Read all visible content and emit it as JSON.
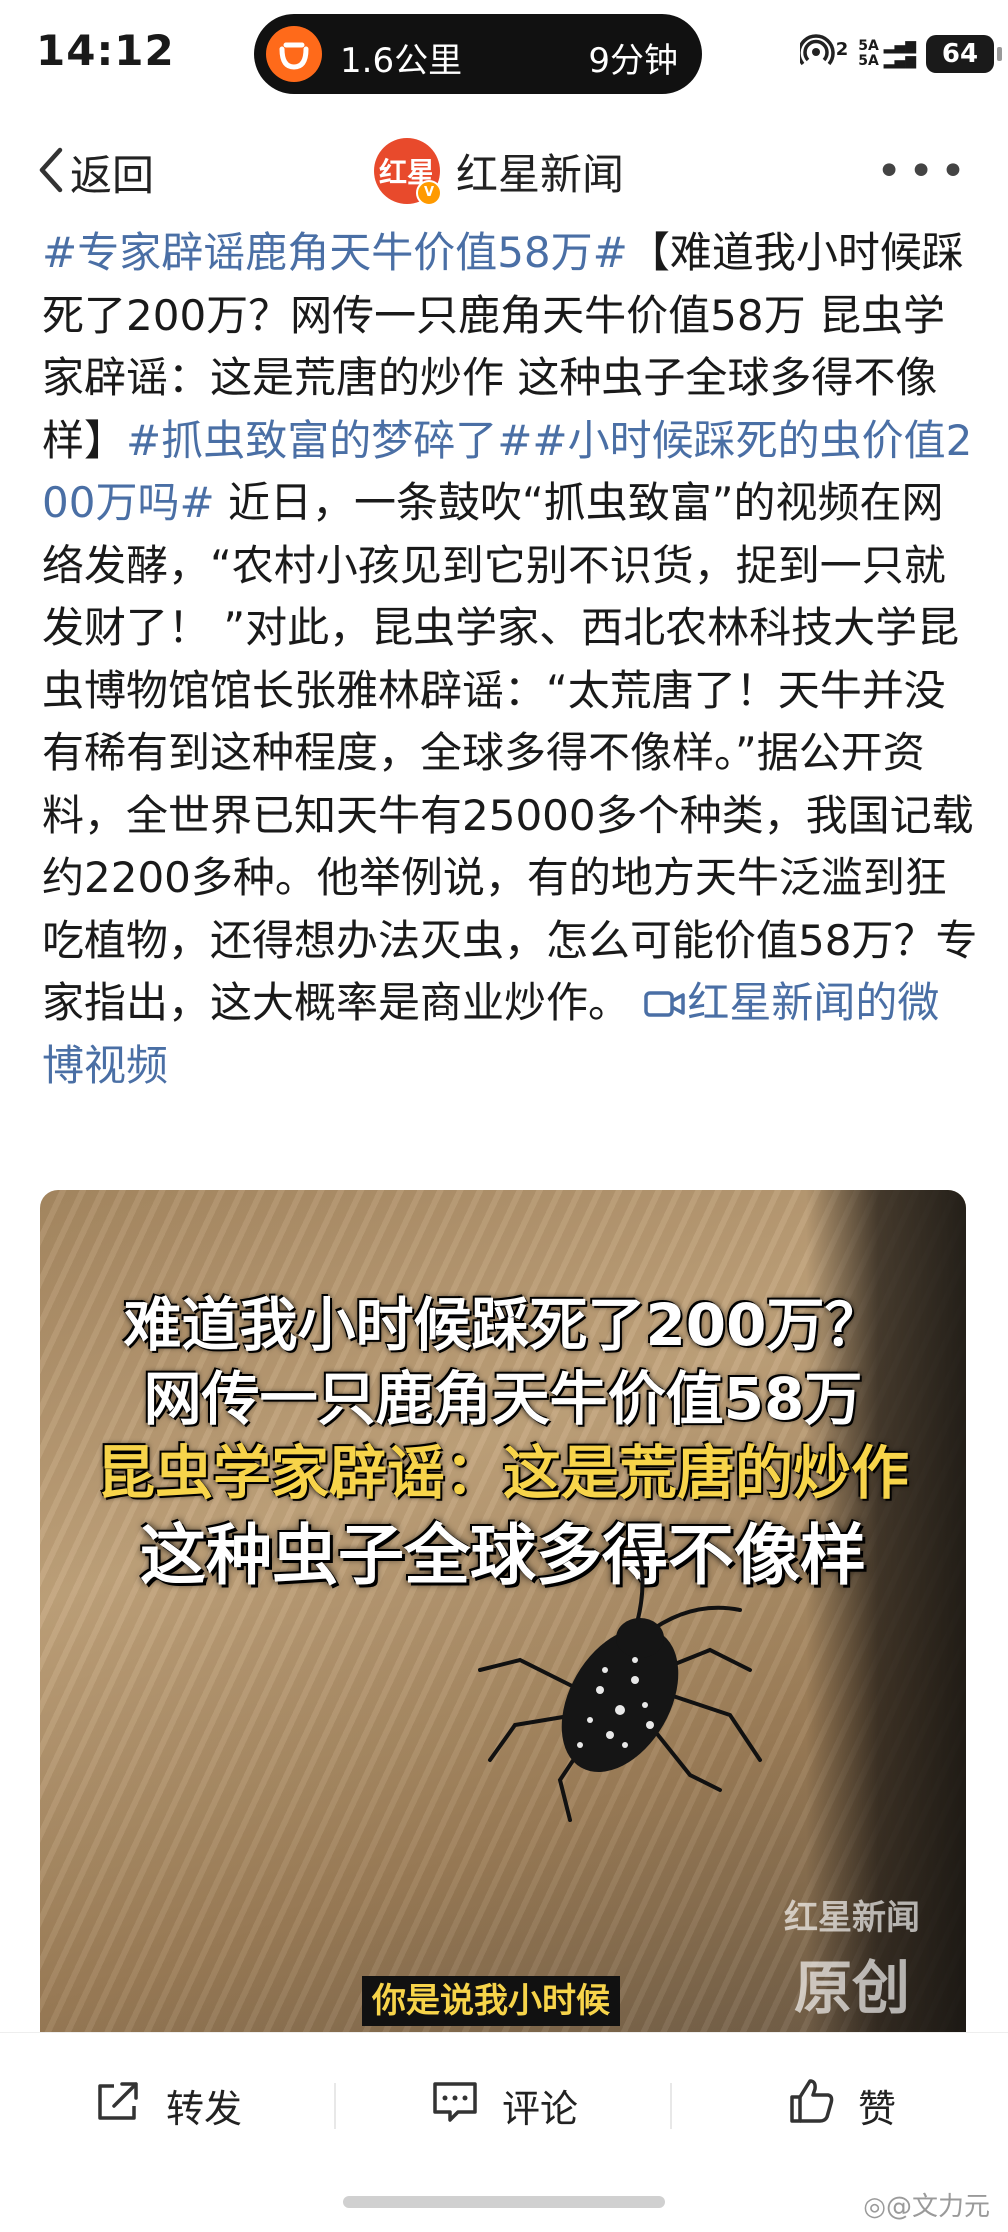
{
  "status_bar": {
    "time": "14:12",
    "nav_distance": "1.6公里",
    "nav_eta": "9分钟",
    "hotspot_badge": "2",
    "signal_top": "5A",
    "signal_bottom": "5A",
    "battery": "64"
  },
  "title_bar": {
    "back_label": "返回",
    "logo_text": "红星",
    "source_name": "红星新闻",
    "more_icon": "more-dots-icon"
  },
  "post": {
    "tag1": "#专家辟谣鹿角天牛价值58万#",
    "headline": "【难道我小时候踩死了200万？网传一只鹿角天牛价值58万 昆虫学家辟谣：这是荒唐的炒作 这种虫子全球多得不像样】",
    "tag2": "#抓虫致富的梦碎了#",
    "tag3": "#小时候踩死的虫价值200万吗#",
    "body": " 近日，一条鼓吹“抓虫致富”的视频在网络发酵，“农村小孩见到它别不识货，捉到一只就发财了！ ”对此，昆虫学家、西北农林科技大学昆虫博物馆馆长张雅林辟谣：“太荒唐了！天牛并没有稀有到这种程度，全球多得不像样。”据公开资料，全世界已知天牛有25000多个种类，我国记载约2200多种。他举例说，有的地方天牛泛滥到狂吃植物，还得想办法灭虫，怎么可能价值58万？专家指出，这大概率是商业炒作。 ",
    "video_link": "红星新闻的微博视频"
  },
  "video": {
    "caption1": "难道我小时候踩死了200万？",
    "caption2": "网传一只鹿角天牛价值58万",
    "caption3": "昆虫学家辟谣：这是荒唐的炒作",
    "caption4": "这种虫子全球多得不像样",
    "watermark_top": "红星新闻",
    "watermark_bottom": "原创",
    "subtitle": "你是说我小时候"
  },
  "actions": {
    "repost": "转发",
    "comment": "评论",
    "like": "赞"
  },
  "credit": "@文力元",
  "colors": {
    "link": "#4a6fa5",
    "accent_orange": "#ff6a1a",
    "brand_red": "#e84a2c",
    "caption_yellow": "#f7d44a"
  }
}
